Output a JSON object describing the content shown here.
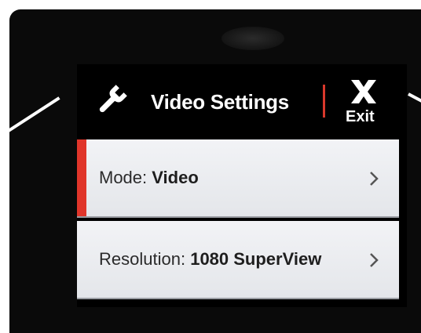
{
  "header": {
    "title": "Video Settings",
    "exit_label": "Exit",
    "settings_icon": "wrench-icon",
    "close_icon": "close-icon",
    "accent_color": "#d8382c"
  },
  "menu": {
    "items": [
      {
        "label": "Mode:",
        "value": "Video",
        "selected": true,
        "icon": "chevron-right-icon"
      },
      {
        "label": "Resolution:",
        "value": "1080 SuperView",
        "selected": false,
        "icon": "chevron-right-icon"
      }
    ]
  },
  "colors": {
    "screen_background": "#000000",
    "row_background": "#eceef2",
    "selected_marker": "#e0352a"
  }
}
